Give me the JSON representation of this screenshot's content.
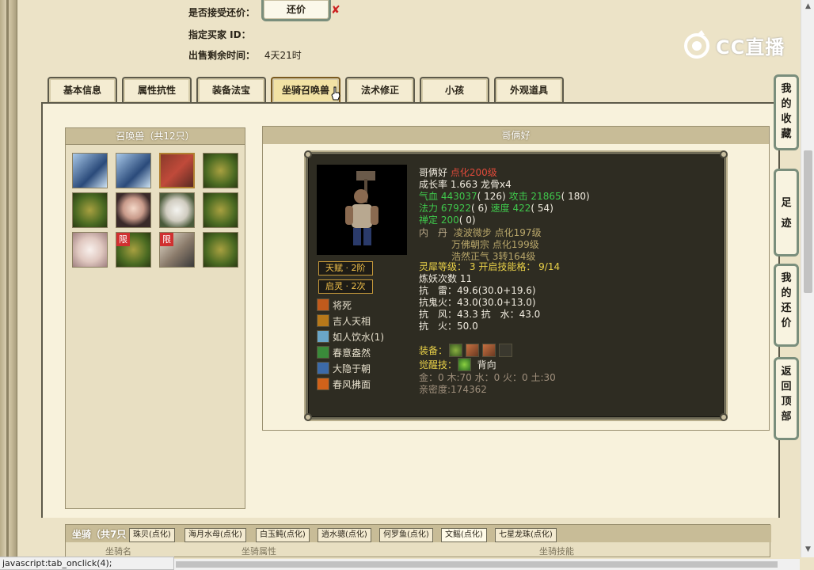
{
  "top_info": {
    "accept_label": "是否接受还价：",
    "counter_button": "还价",
    "buyer_label": "指定买家 ID：",
    "remaining_label": "出售剩余时间：",
    "remaining_value": "4天21时"
  },
  "logo": {
    "text": "CC直播"
  },
  "tabs": [
    {
      "label": "基本信息"
    },
    {
      "label": "属性抗性"
    },
    {
      "label": "装备法宝"
    },
    {
      "label": "坐骑召唤兽"
    },
    {
      "label": "法术修正"
    },
    {
      "label": "小孩"
    },
    {
      "label": "外观道具"
    }
  ],
  "pet_panel": {
    "title": "召唤兽（共12只）",
    "limit_badge": "限"
  },
  "detail": {
    "title": "哥俩好",
    "name": "哥俩好",
    "level": "点化200级",
    "growth_label": "成长率",
    "growth_value": "1.663",
    "bone": "龙骨x4",
    "hp_label": "气血",
    "hp_value": "443037",
    "hp_extra": "( 126)",
    "atk_label": "攻击",
    "atk_value": "21865",
    "atk_extra": "( 180)",
    "mp_label": "法力",
    "mp_value": "67922",
    "mp_extra": "( 6)",
    "spd_label": "速度",
    "spd_value": "422",
    "spd_extra": "( 54)",
    "zen_label": "禅定",
    "zen_value": "200",
    "zen_extra": "( 0)",
    "inner_label": "内　丹",
    "inner1": "凌波微步 点化197级",
    "inner2": "万佛朝宗 点化199级",
    "inner3": "浩然正气 3转164级",
    "spirit_label": "灵犀等级：",
    "spirit_value": "3",
    "skill_open_label": "开启技能格：",
    "skill_open_value": "9/14",
    "refine_label": "炼妖次数",
    "refine_value": "11",
    "res1_label": "抗　雷：",
    "res1_value": "49.6(30.0+19.6)",
    "res2_label": "抗鬼火：",
    "res2_value": "43.0(30.0+13.0)",
    "res3_label": "抗　风：",
    "res3_value": "43.3",
    "res3b_label": "抗　水：",
    "res3b_value": "43.0",
    "res4_label": "抗　火：",
    "res4_value": "50.0",
    "equip_label": "装备：",
    "awaken_label": "觉醒技：",
    "awaken_value": "背向",
    "elements": "金：0 木:70 水：0 火：0 土:30",
    "intimacy": "亲密度:174362",
    "talent_badge": "天赋 · 2阶",
    "spirit_badge": "启灵 · 2次",
    "skills": [
      {
        "name": "将死",
        "color": "#c05a1c"
      },
      {
        "name": "吉人天相",
        "color": "#b7781a"
      },
      {
        "name": "如人饮水(1)",
        "color": "#6aa6c8"
      },
      {
        "name": "春意盎然",
        "color": "#3a8a3a"
      },
      {
        "name": "大隐于朝",
        "color": "#3c6aa8"
      },
      {
        "name": "春风拂面",
        "color": "#d0621a"
      }
    ]
  },
  "mount": {
    "title": "坐骑（共7只",
    "tabs": [
      {
        "label": "珠贝(点化)"
      },
      {
        "label": "海月水母(点化)"
      },
      {
        "label": "白玉鲀(点化)"
      },
      {
        "label": "逍水骢(点化)"
      },
      {
        "label": "何罗鱼(点化)"
      },
      {
        "label": "文鳐(点化)"
      },
      {
        "label": "七星龙珠(点化)"
      }
    ],
    "col_name": "坐骑名",
    "col_attr": "坐骑属性",
    "col_skill": "坐骑技能"
  },
  "float_buttons": [
    {
      "label": "我的收藏"
    },
    {
      "label": "足迹"
    },
    {
      "label": "我的还价"
    },
    {
      "label": "返回顶部"
    }
  ],
  "status_bar": "javascript:tab_onclick(4);"
}
